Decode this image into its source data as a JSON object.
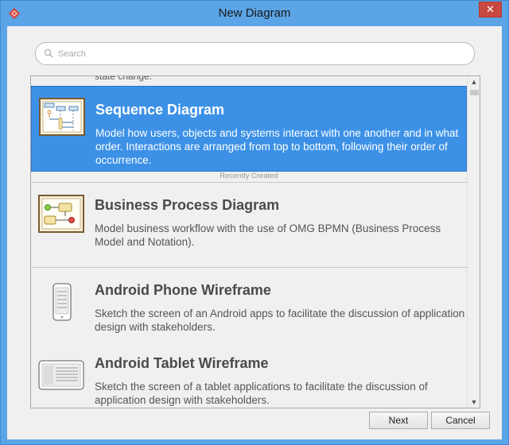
{
  "window": {
    "title": "New Diagram",
    "close_glyph": "✕"
  },
  "search": {
    "placeholder": "Search",
    "value": ""
  },
  "list": {
    "partial_previous_desc": "state change.",
    "recent_label": "Recently Created",
    "items": [
      {
        "title": "Sequence Diagram",
        "desc": "Model how users, objects and systems interact with one another and in what order. Interactions are arranged from top to bottom, following their order of occurrence.",
        "icon": "sequence-diagram-icon",
        "selected": true
      },
      {
        "title": "Business Process Diagram",
        "desc": "Model business workflow with the use of OMG BPMN (Business Process Model and Notation).",
        "icon": "business-process-diagram-icon",
        "selected": false
      },
      {
        "title": "Android Phone Wireframe",
        "desc": "Sketch the screen of an Android apps to facilitate the discussion of application design with stakeholders.",
        "icon": "android-phone-icon",
        "selected": false
      },
      {
        "title": "Android Tablet Wireframe",
        "desc": "Sketch the screen of a tablet applications to facilitate the discussion of application design with stakeholders.",
        "icon": "android-tablet-icon",
        "selected": false
      }
    ]
  },
  "buttons": {
    "next": "Next",
    "cancel": "Cancel"
  },
  "colors": {
    "selection": "#3c91e6",
    "titlebar": "#5ba4e5",
    "close": "#c7483f"
  }
}
